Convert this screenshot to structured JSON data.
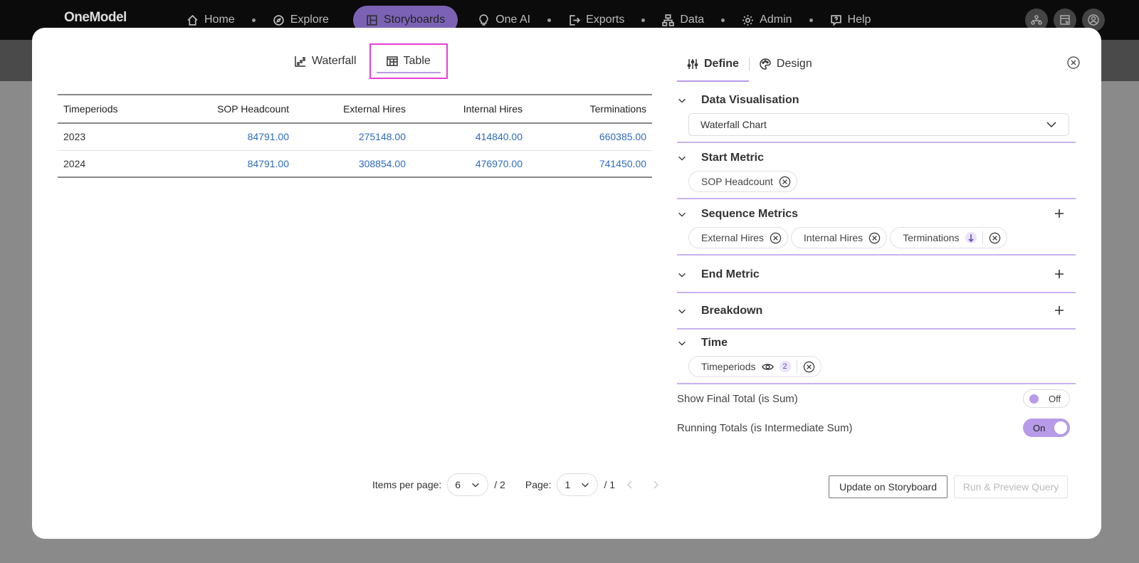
{
  "nav": {
    "logo": "OneModel",
    "items": [
      {
        "label": "Home",
        "icon": "home-icon"
      },
      {
        "label": "Explore",
        "icon": "compass-icon"
      },
      {
        "label": "Storyboards",
        "icon": "storyboard-icon",
        "active": true
      },
      {
        "label": "One AI",
        "icon": "bulb-icon"
      },
      {
        "label": "Exports",
        "icon": "export-icon"
      },
      {
        "label": "Data",
        "icon": "data-icon"
      },
      {
        "label": "Admin",
        "icon": "gear-icon"
      },
      {
        "label": "Help",
        "icon": "help-icon"
      }
    ]
  },
  "view_tabs": {
    "waterfall": "Waterfall",
    "table": "Table"
  },
  "table": {
    "headers": [
      "Timeperiods",
      "SOP Headcount",
      "External Hires",
      "Internal Hires",
      "Terminations"
    ],
    "rows": [
      [
        "2023",
        "84791.00",
        "275148.00",
        "414840.00",
        "660385.00"
      ],
      [
        "2024",
        "84791.00",
        "308854.00",
        "476970.00",
        "741450.00"
      ]
    ]
  },
  "pager": {
    "items_per_page_label": "Items per page:",
    "items_per_page_value": "6",
    "items_total": "/ 2",
    "page_label": "Page:",
    "page_value": "1",
    "page_total": "/ 1"
  },
  "panel_tabs": {
    "define": "Define",
    "design": "Design"
  },
  "sections": {
    "data_visualisation": {
      "title": "Data Visualisation",
      "value": "Waterfall Chart"
    },
    "start_metric": {
      "title": "Start Metric",
      "chips": [
        "SOP Headcount"
      ]
    },
    "sequence_metrics": {
      "title": "Sequence Metrics",
      "chips": [
        "External Hires",
        "Internal Hires",
        "Terminations"
      ]
    },
    "end_metric": {
      "title": "End Metric"
    },
    "breakdown": {
      "title": "Breakdown"
    },
    "time": {
      "title": "Time",
      "chip": "Timeperiods",
      "badge": "2"
    }
  },
  "toggles": {
    "show_final_total": {
      "label": "Show Final Total (is Sum)",
      "state": "Off"
    },
    "running_totals": {
      "label": "Running Totals (is Intermediate Sum)",
      "state": "On"
    }
  },
  "buttons": {
    "update": "Update on Storyboard",
    "run_preview": "Run & Preview Query"
  },
  "colors": {
    "accent": "#b79be8",
    "link": "#2e6bbf",
    "highlight": "#e83fd6"
  }
}
